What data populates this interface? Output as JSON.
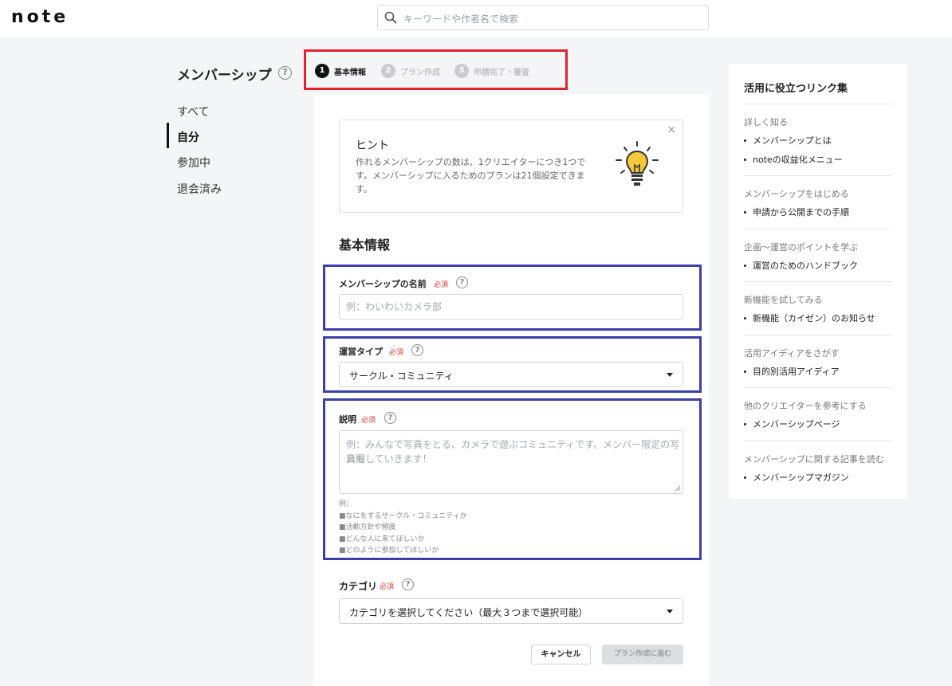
{
  "header": {
    "logo": "note",
    "search_placeholder": "キーワードや作者名で検索"
  },
  "page": {
    "title": "メンバーシップ",
    "help_glyph": "?"
  },
  "left_nav": {
    "items": [
      {
        "label": "すべて",
        "active": false
      },
      {
        "label": "自分",
        "active": true
      },
      {
        "label": "参加中",
        "active": false
      },
      {
        "label": "退会済み",
        "active": false
      }
    ]
  },
  "stepper": {
    "steps": [
      {
        "num": "1",
        "label": "基本情報",
        "active": true
      },
      {
        "num": "2",
        "label": "プラン作成",
        "active": false
      },
      {
        "num": "3",
        "label": "申請完了・審査",
        "active": false
      }
    ]
  },
  "hint": {
    "title": "ヒント",
    "body": "作れるメンバーシップの数は、1クリエイターにつき1つです。メンバーシップに入るためのプランは21個設定できます。",
    "close": "×"
  },
  "form": {
    "section_title": "基本情報",
    "required_label": "必須",
    "name": {
      "label": "メンバーシップの名前",
      "placeholder": "例：わいわいカメラ部"
    },
    "type": {
      "label": "運営タイプ",
      "value": "サークル・コミュニティ"
    },
    "description": {
      "label": "説明",
      "placeholder_line1": "例：みんなで写真をとる、カメラで遊ぶコミュニティです。メンバー限定の写真も",
      "placeholder_line2": "公開していきます！",
      "examples": [
        "例：",
        "■なにをするサークル・コミュニティか",
        "■活動方針や頻度",
        "■どんな人に来てほしいか",
        "■どのように参加してほしいか"
      ]
    },
    "category": {
      "label": "カテゴリ",
      "value": "カテゴリを選択してください（最大３つまで選択可能）"
    },
    "cancel_label": "キャンセル",
    "next_label": "プラン作成に進む"
  },
  "right_panel": {
    "title": "活用に役立つリンク集",
    "groups": [
      {
        "heading": "詳しく知る",
        "links": [
          "メンバーシップとは",
          "noteの収益化メニュー"
        ]
      },
      {
        "heading": "メンバーシップをはじめる",
        "links": [
          "申請から公開までの手順"
        ]
      },
      {
        "heading": "企画〜運営のポイントを学ぶ",
        "links": [
          "運営のためのハンドブック"
        ]
      },
      {
        "heading": "新機能を試してみる",
        "links": [
          "新機能（カイゼン）のお知らせ"
        ]
      },
      {
        "heading": "活用アイディアをさがす",
        "links": [
          "目的別活用アイディア"
        ]
      },
      {
        "heading": "他のクリエイターを参考にする",
        "links": [
          "メンバーシップページ"
        ]
      },
      {
        "heading": "メンバーシップに関する記事を読む",
        "links": [
          "メンバーシップマガジン"
        ]
      }
    ]
  },
  "colors": {
    "annotation_red": "#e0242e",
    "annotation_blue": "#3d3fa6",
    "required_red": "#d33a3a"
  }
}
